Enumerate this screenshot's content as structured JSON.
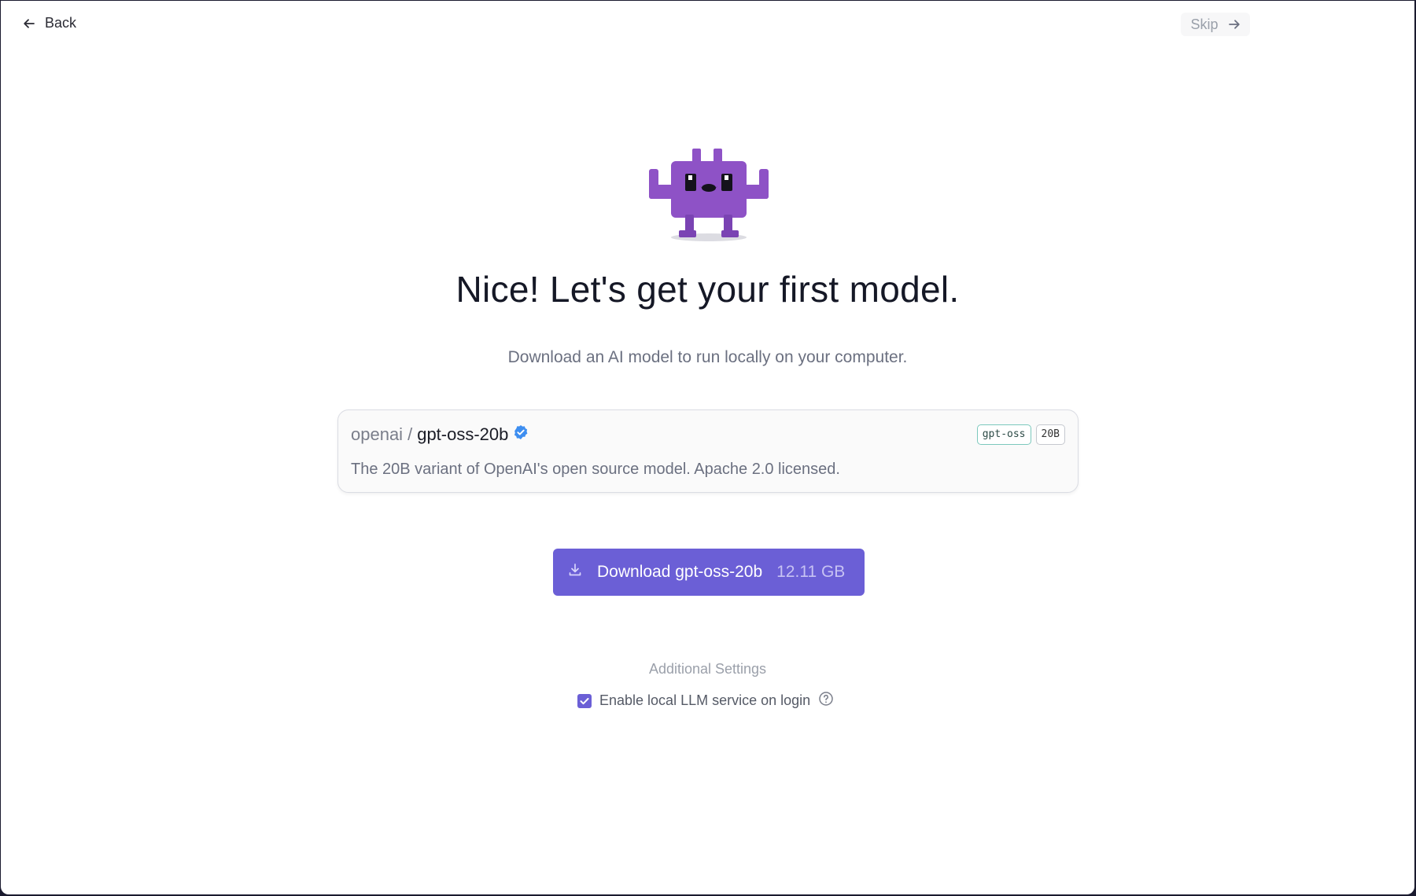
{
  "topbar": {
    "back_label": "Back",
    "skip_label": "Skip"
  },
  "hero": {
    "headline": "Nice! Let's get your first model.",
    "subline": "Download an AI model to run locally on your computer."
  },
  "model": {
    "org": "openai",
    "separator": "/",
    "name": "gpt-oss-20b",
    "verified_icon": "verified-badge-icon",
    "tags": [
      "gpt-oss",
      "20B"
    ],
    "description": "The 20B variant of OpenAI's open source model. Apache 2.0 licensed."
  },
  "download": {
    "label": "Download gpt-oss-20b",
    "size": "12.11 GB",
    "icon": "download-icon"
  },
  "settings": {
    "heading": "Additional Settings",
    "checkbox_label": "Enable local LLM service on login",
    "checkbox_checked": true,
    "help_icon": "help-circle-icon"
  },
  "colors": {
    "accent": "#6b5fd6",
    "mascot": "#8e52c6",
    "tag_family_border": "#7cc8bd",
    "verified": "#3d8ef0"
  }
}
